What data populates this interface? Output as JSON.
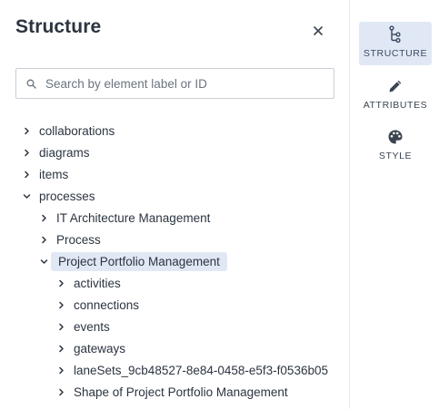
{
  "panel": {
    "title": "Structure",
    "close_icon": "close-icon"
  },
  "search": {
    "placeholder": "Search by element label or ID",
    "value": "",
    "icon": "search-icon"
  },
  "tree": {
    "items": [
      {
        "label": "collaborations",
        "level": 0,
        "expanded": false,
        "selected": false
      },
      {
        "label": "diagrams",
        "level": 0,
        "expanded": false,
        "selected": false
      },
      {
        "label": "items",
        "level": 0,
        "expanded": false,
        "selected": false
      },
      {
        "label": "processes",
        "level": 0,
        "expanded": true,
        "selected": false
      },
      {
        "label": "IT Architecture Management",
        "level": 1,
        "expanded": false,
        "selected": false
      },
      {
        "label": "Process",
        "level": 1,
        "expanded": false,
        "selected": false
      },
      {
        "label": "Project Portfolio Management",
        "level": 1,
        "expanded": true,
        "selected": true
      },
      {
        "label": "activities",
        "level": 2,
        "expanded": false,
        "selected": false
      },
      {
        "label": "connections",
        "level": 2,
        "expanded": false,
        "selected": false
      },
      {
        "label": "events",
        "level": 2,
        "expanded": false,
        "selected": false
      },
      {
        "label": "gateways",
        "level": 2,
        "expanded": false,
        "selected": false
      },
      {
        "label": "laneSets_9cb48527-8e84-0458-e5f3-f0536b05",
        "level": 2,
        "expanded": false,
        "selected": false
      },
      {
        "label": "Shape of Project Portfolio Management",
        "level": 2,
        "expanded": false,
        "selected": false
      }
    ]
  },
  "sidebar": {
    "items": [
      {
        "label": "STRUCTURE",
        "icon": "structure-icon",
        "active": true
      },
      {
        "label": "ATTRIBUTES",
        "icon": "pencil-icon",
        "active": false
      },
      {
        "label": "STYLE",
        "icon": "palette-icon",
        "active": false
      }
    ]
  },
  "colors": {
    "selection": "#e1e8f5",
    "text": "#2b3440",
    "border": "#c9cfd6"
  }
}
